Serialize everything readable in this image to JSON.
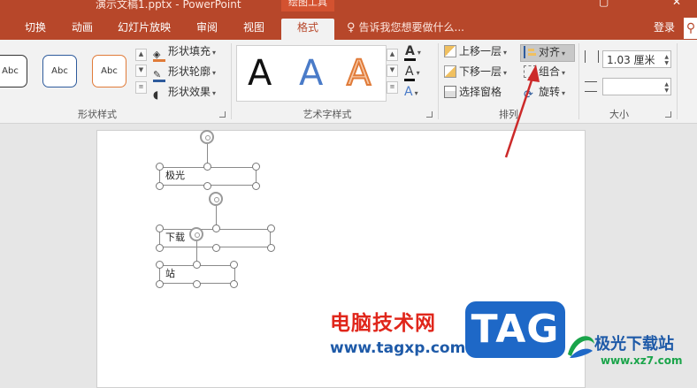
{
  "window": {
    "title": "演示文稿1.pptx - PowerPoint",
    "context_label": "绘图工具"
  },
  "tabs": [
    {
      "label": "切换"
    },
    {
      "label": "动画"
    },
    {
      "label": "幻灯片放映"
    },
    {
      "label": "审阅"
    },
    {
      "label": "视图"
    },
    {
      "label": "格式",
      "active": true
    }
  ],
  "tell_me": "告诉我您想要做什么...",
  "login": "登录",
  "ribbon": {
    "shape_styles": {
      "presets": [
        "Abc",
        "Abc",
        "Abc",
        "Abc"
      ],
      "fill": "形状填充",
      "outline": "形状轮廓",
      "effects": "形状效果",
      "label": "形状样式"
    },
    "wordart": {
      "presets": [
        "A",
        "A",
        "A"
      ],
      "label": "艺术字样式"
    },
    "arrange": {
      "bring_forward": "上移一层",
      "send_backward": "下移一层",
      "selection_pane": "选择窗格",
      "align": "对齐",
      "group": "组合",
      "rotate": "旋转",
      "label": "排列"
    },
    "size": {
      "height_value": "1.03 厘米",
      "width_value": "",
      "label": "大小"
    }
  },
  "slide": {
    "textboxes": [
      "极光",
      "下载",
      "站"
    ]
  },
  "watermark": {
    "cn": "电脑技术网",
    "url": "www.tagxp.com",
    "badge": "TAG",
    "brand": "极光下载站",
    "brand_url": "www.xz7.com"
  },
  "colors": {
    "accent": "#b7472a",
    "annotation_arrow": "#cc2a2a"
  }
}
